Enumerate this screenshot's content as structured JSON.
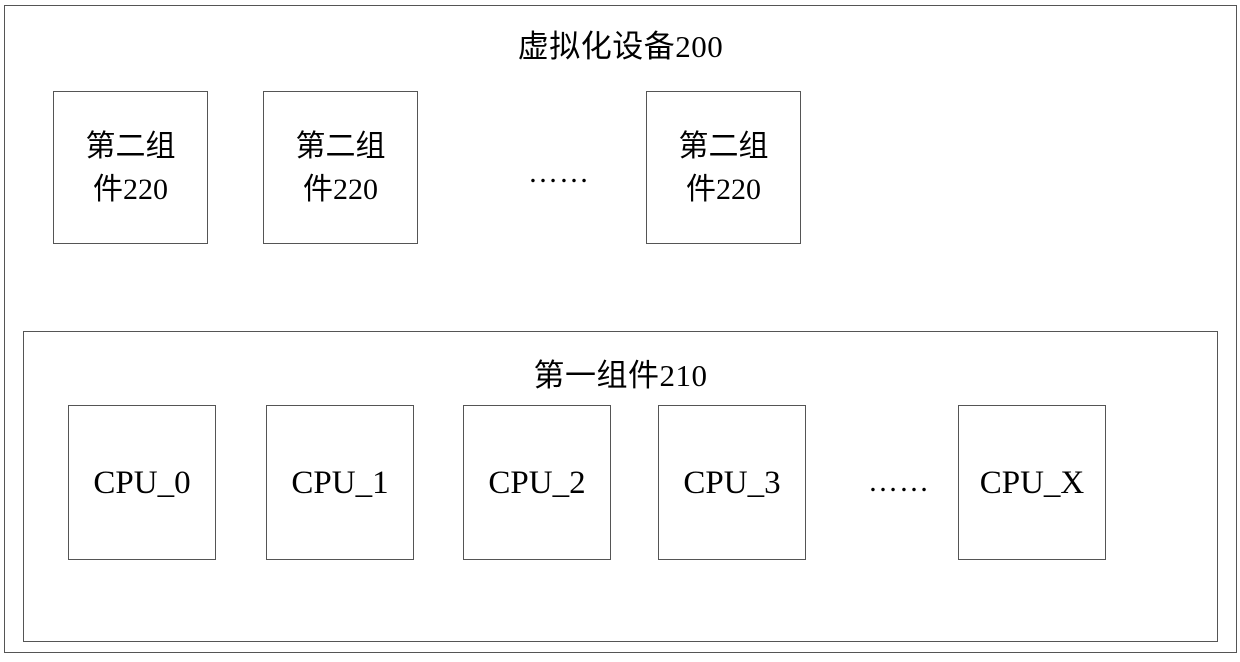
{
  "diagram": {
    "device": {
      "title": "虚拟化设备200",
      "second_components": [
        {
          "label": "第二组件220"
        },
        {
          "label": "第二组件220"
        },
        {
          "label": "第二组件220"
        }
      ],
      "second_row_ellipsis": "……",
      "first_component": {
        "title": "第一组件210",
        "cpus": [
          {
            "label": "CPU_0"
          },
          {
            "label": "CPU_1"
          },
          {
            "label": "CPU_2"
          },
          {
            "label": "CPU_3"
          },
          {
            "label": "CPU_X"
          }
        ],
        "cpu_row_ellipsis": "……"
      }
    },
    "colors": {
      "background": "#ffffff",
      "line": "#555555",
      "text": "#000000"
    }
  }
}
